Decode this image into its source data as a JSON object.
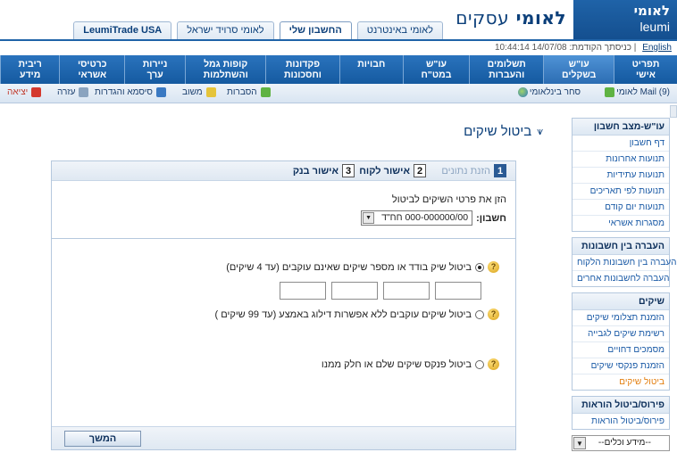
{
  "brand": {
    "logo_he": "לאומי",
    "logo_en": "leumi",
    "app_title_he": "לאומי",
    "app_title_rest": "עסקים"
  },
  "top_tabs": [
    {
      "label": "לאומי באינטרנט",
      "active": false
    },
    {
      "label": "החשבון שלי",
      "active": true
    },
    {
      "label": "לאומי סרויד ישראל",
      "active": false
    },
    {
      "label": "LeumiTrade USA",
      "active": false,
      "en": true
    }
  ],
  "subheader": {
    "english_link": "English",
    "separator": "|",
    "last_login": "10:44:14 14/07/08 :כניסתך הקודמת"
  },
  "main_nav": [
    {
      "label": "תפריט\nאישי",
      "active": false
    },
    {
      "label": "עו\"ש\nבשקלים",
      "active": true
    },
    {
      "label": "תשלומים\nוהעברות",
      "active": false
    },
    {
      "label": "עו\"ש\nבמט\"ח",
      "active": false
    },
    {
      "label": "חבויות",
      "active": false
    },
    {
      "label": "פקדונות\nוחסכונות",
      "active": false
    },
    {
      "label": "קופות גמל\nוהשתלמות",
      "active": false
    },
    {
      "label": "ניירות\nערך",
      "active": false
    },
    {
      "label": "כרטיסי\nאשראי",
      "active": false
    },
    {
      "label": "ריבית\nמידע",
      "active": false
    }
  ],
  "utility_bar": {
    "mail": "לאומי Mail (9)",
    "dollar_trade": "סחר בינלאומי",
    "exit": "יציאה",
    "help": "עזרה",
    "password": "סיסמא והגדרות",
    "feedback": "משוב",
    "explanations": "הסברות"
  },
  "sidebar": {
    "groups": [
      {
        "title": "עו\"ש-מצב חשבון",
        "items": [
          "דף חשבון",
          "תנועות אחרונות",
          "תנועות עתידיות",
          "תנועות לפי תאריכים",
          "תנועות יום קודם",
          "מסגרות אשראי"
        ]
      },
      {
        "title": "העברה בין חשבונות",
        "items": [
          "העברה בין חשבונות הלקוח",
          "העברה לחשבונות אחרים"
        ]
      },
      {
        "title": "שיקים",
        "items": [
          "הזמנת תצלומי שיקים",
          "רשימת שיקים לגבייה",
          "מסמכים דחויים",
          "הזמנת פנקסי שיקים",
          "ביטול שיקים"
        ],
        "active_index": 4
      },
      {
        "title": "פירוס/ביטול הוראות",
        "items": [
          "פירוס/ביטול הוראות"
        ]
      }
    ],
    "select_value": "--מידע וכלים--"
  },
  "page": {
    "title": "ביטול שיקים",
    "steps": [
      {
        "num": "1",
        "label": "הזנת נתונים",
        "active": true
      },
      {
        "num": "2",
        "label": "אישור לקוח",
        "active": false
      },
      {
        "num": "3",
        "label": "אישור בנק",
        "active": false
      }
    ],
    "instruction": "הזן את פרטי השיקים לביטול",
    "account_label": "חשבון:",
    "account_value": "000-000000/00 חח\"ד",
    "options": [
      {
        "label": "ביטול שיק בודד או מספר שיקים שאינם עוקבים (עד 4 שיקים)",
        "selected": true
      },
      {
        "label": "ביטול שיקים עוקבים ללא אפשרות דילוג באמצע (עד 99 שיקים )",
        "selected": false
      },
      {
        "label": "ביטול פנקס שיקים שלם או חלק ממנו",
        "selected": false
      }
    ],
    "continue_label": "המשך"
  }
}
